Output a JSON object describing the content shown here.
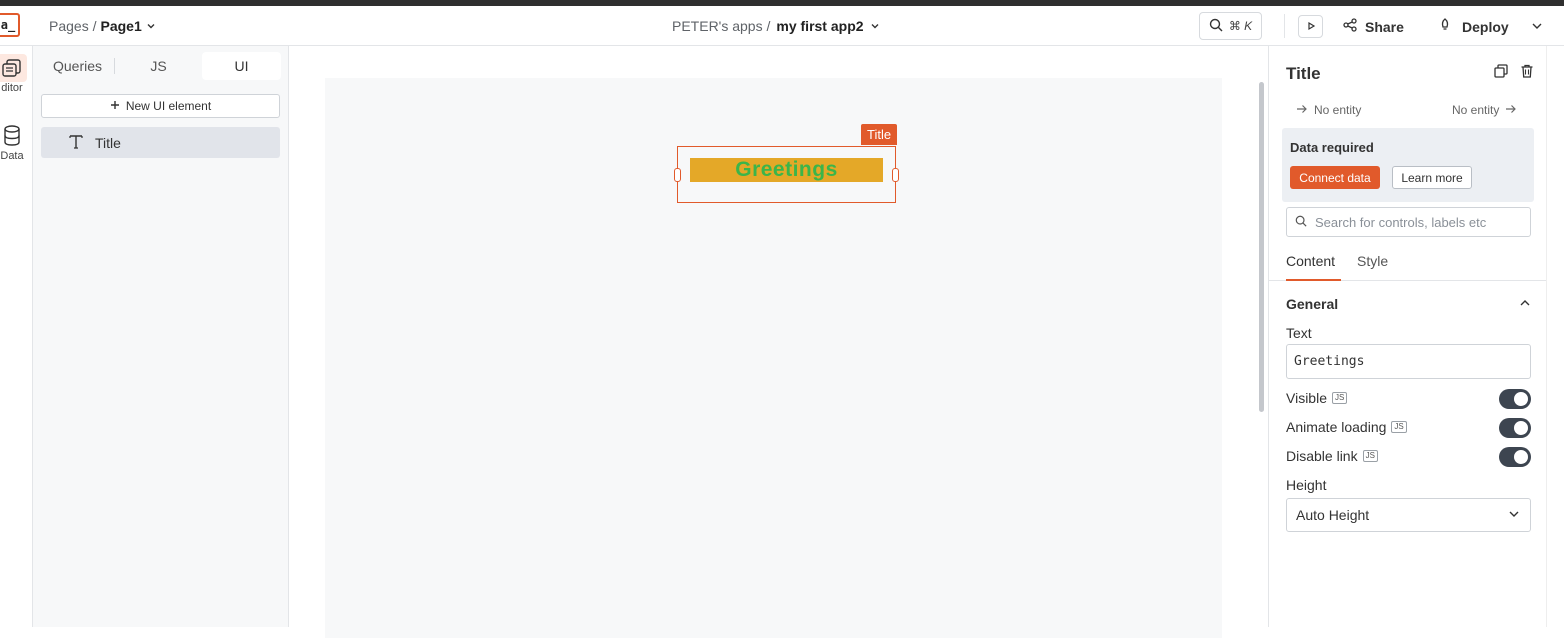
{
  "header": {
    "logo_text": "a_",
    "pages_label": "Pages /",
    "current_page": "Page1",
    "workspace": "PETER's apps /",
    "app_name": "my first app2",
    "shortcut": "⌘ K",
    "share_label": "Share",
    "deploy_label": "Deploy"
  },
  "rail": {
    "items": [
      {
        "label": "ditor"
      },
      {
        "label": "Data"
      }
    ]
  },
  "explorer": {
    "tabs": [
      "Queries",
      "JS",
      "UI"
    ],
    "active_tab": "UI",
    "new_button": "New UI element",
    "widgets": [
      {
        "label": "Title"
      }
    ]
  },
  "canvas": {
    "selected_tag": "Title",
    "widget_text": "Greetings",
    "widget_bg": "#e4a828",
    "widget_text_color": "#3bb54a"
  },
  "props": {
    "title": "Title",
    "entity_left": "No entity",
    "entity_right": "No entity",
    "data_required": "Data required",
    "connect_label": "Connect data",
    "learn_label": "Learn more",
    "search_placeholder": "Search for controls, labels etc",
    "tabs": [
      "Content",
      "Style"
    ],
    "active_tab": "Content",
    "section": "General",
    "text_label": "Text",
    "text_value": "Greetings",
    "visible_label": "Visible",
    "animate_label": "Animate loading",
    "disable_link_label": "Disable link",
    "js_badge": "JS",
    "height_label": "Height",
    "height_value": "Auto Height"
  },
  "colors": {
    "accent": "#e15a2b",
    "toggle_on": "#3d4550"
  }
}
